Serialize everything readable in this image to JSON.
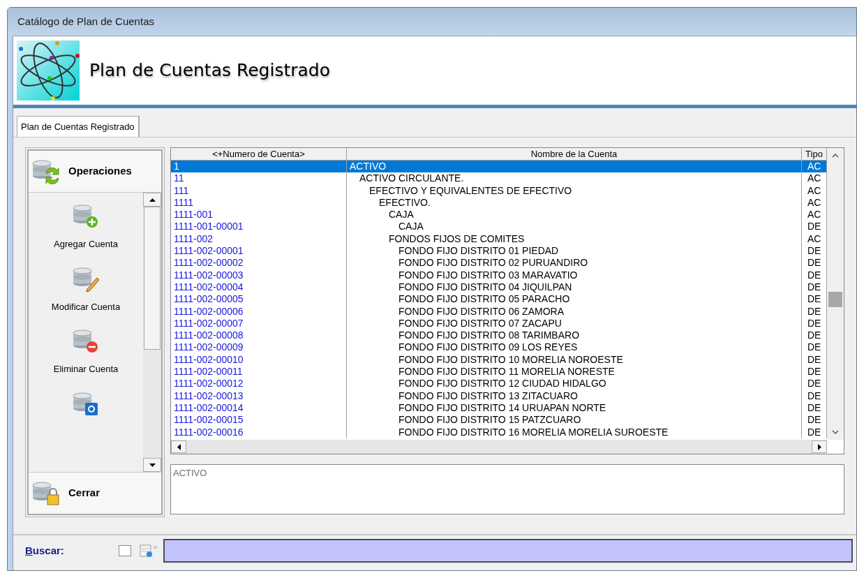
{
  "window": {
    "title": "Catálogo de Plan de Cuentas"
  },
  "header": {
    "title": "Plan de Cuentas Registrado"
  },
  "tabs": [
    {
      "label": "Plan de Cuentas Registrado",
      "selected": true
    }
  ],
  "sidebar": {
    "group_title": "Operaciones",
    "items": [
      {
        "label": "Agregar Cuenta",
        "kind": "add"
      },
      {
        "label": "Modificar Cuenta",
        "kind": "edit"
      },
      {
        "label": "Eliminar Cuenta",
        "kind": "delete"
      },
      {
        "kind": "change"
      }
    ],
    "footer_title": "Cerrar"
  },
  "table": {
    "columns": [
      "<+Numero de Cuenta>",
      "Nombre de la Cuenta",
      "Tipo"
    ],
    "rows": [
      {
        "number": "1",
        "name": "ACTIVO",
        "type": "AC",
        "selected": true,
        "children": [
          {
            "number": "11",
            "name": "ACTIVO CIRCULANTE.",
            "type": "AC",
            "selected": false,
            "children": [
              {
                "number": "111",
                "name": "EFECTIVO Y EQUIVALENTES DE EFECTIVO",
                "type": "AC",
                "selected": false,
                "children": [
                  {
                    "number": "1111",
                    "name": "EFECTIVO.",
                    "type": "AC",
                    "selected": false,
                    "children": [
                      {
                        "number": "1111-001",
                        "name": "CAJA",
                        "type": "AC",
                        "selected": false,
                        "children": [
                          {
                            "number": "1111-001-00001",
                            "name": "CAJA",
                            "type": "DE",
                            "selected": false
                          }
                        ]
                      },
                      {
                        "number": "1111-002",
                        "name": "FONDOS FIJOS DE COMITES",
                        "type": "AC",
                        "selected": false,
                        "children": [
                          {
                            "number": "1111-002-00001",
                            "name": "FONDO FIJO DISTRITO 01 PIEDAD",
                            "type": "DE",
                            "selected": false
                          },
                          {
                            "number": "1111-002-00002",
                            "name": "FONDO FIJO DISTRITO 02 PURUANDIRO",
                            "type": "DE",
                            "selected": false
                          },
                          {
                            "number": "1111-002-00003",
                            "name": "FONDO FIJO DISTRITO 03 MARAVATIO",
                            "type": "DE",
                            "selected": false
                          },
                          {
                            "number": "1111-002-00004",
                            "name": "FONDO FIJO DISTRITO 04 JIQUILPAN",
                            "type": "DE",
                            "selected": false
                          },
                          {
                            "number": "1111-002-00005",
                            "name": "FONDO FIJO DISTRITO 05 PARACHO",
                            "type": "DE",
                            "selected": false
                          },
                          {
                            "number": "1111-002-00006",
                            "name": "FONDO FIJO DISTRITO 06 ZAMORA",
                            "type": "DE",
                            "selected": false
                          },
                          {
                            "number": "1111-002-00007",
                            "name": "FONDO FIJO DISTRITO 07 ZACAPU",
                            "type": "DE",
                            "selected": false
                          },
                          {
                            "number": "1111-002-00008",
                            "name": "FONDO FIJO DISTRITO 08 TARIMBARO",
                            "type": "DE",
                            "selected": false
                          },
                          {
                            "number": "1111-002-00009",
                            "name": "FONDO FIJO DISTRITO 09 LOS REYES",
                            "type": "DE",
                            "selected": false
                          },
                          {
                            "number": "1111-002-00010",
                            "name": "FONDO FIJO DISTRITO 10 MORELIA NOROESTE",
                            "type": "DE",
                            "selected": false
                          },
                          {
                            "number": "1111-002-00011",
                            "name": "FONDO FIJO DISTRITO 11 MORELIA NORESTE",
                            "type": "DE",
                            "selected": false
                          },
                          {
                            "number": "1111-002-00012",
                            "name": "FONDO FIJO DISTRITO 12 CIUDAD HIDALGO",
                            "type": "DE",
                            "selected": false
                          },
                          {
                            "number": "1111-002-00013",
                            "name": "FONDO FIJO DISTRITO 13 ZITACUARO",
                            "type": "DE",
                            "selected": false
                          },
                          {
                            "number": "1111-002-00014",
                            "name": "FONDO FIJO DISTRITO 14 URUAPAN NORTE",
                            "type": "DE",
                            "selected": false
                          },
                          {
                            "number": "1111-002-00015",
                            "name": "FONDO FIJO DISTRITO 15 PATZCUARO",
                            "type": "DE",
                            "selected": false
                          },
                          {
                            "number": "1111-002-00016",
                            "name": "FONDO FIJO DISTRITO 16 MORELIA MORELIA SUROESTE",
                            "type": "DE",
                            "selected": false
                          }
                        ]
                      }
                    ]
                  }
                ]
              }
            ]
          }
        ]
      }
    ]
  },
  "detail": {
    "value": "ACTIVO"
  },
  "search": {
    "label": "Buscar:",
    "checked": false
  }
}
